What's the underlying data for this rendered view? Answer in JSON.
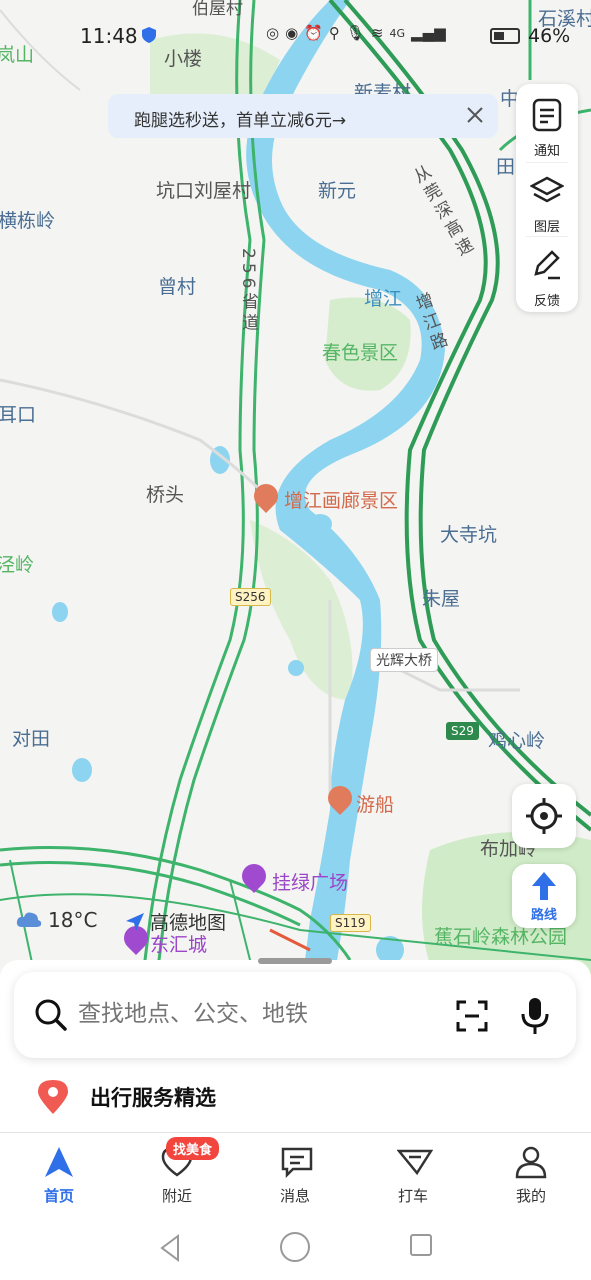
{
  "status_bar": {
    "time": "11:48",
    "battery_percent": "46%",
    "network": "4G"
  },
  "promo": {
    "text": "跑腿选秒送，首单立减6元→"
  },
  "tools": [
    {
      "label": "通知",
      "icon": "notification-icon"
    },
    {
      "label": "图层",
      "icon": "layers-icon"
    },
    {
      "label": "反馈",
      "icon": "feedback-icon"
    }
  ],
  "route_button": {
    "label": "路线"
  },
  "weather": {
    "temperature": "18°C"
  },
  "brand": {
    "name": "高德地图"
  },
  "map_labels": {
    "xiaolou": "小楼",
    "xinmaicun": "新麦村",
    "kengkou": "坑口刘屋村",
    "xinyuan": "新元",
    "hengdongling": "横栋岭",
    "zengcun": "曾村",
    "chunse": "春色景区",
    "zengjiang_river": "增江",
    "zengjiang_road": "增江路",
    "road_256": "256省道",
    "expressway": "从莞深高速",
    "qiaotou": "桥头",
    "huang_scenic": "增江画廊景区",
    "dasikeng": "大寺坑",
    "zhuwu": "朱屋",
    "duitian": "对田",
    "jixinling": "鸡心岭",
    "youchuan": "游船",
    "bujia": "布加岭",
    "guilu": "挂绿广场",
    "donghui": "东汇城",
    "jiaoshiling": "蕉石岭森林公园",
    "guanghui_bridge": "光辉大桥",
    "shixi": "石溪村",
    "jingling": "泾岭",
    "erkeng": "耳口",
    "shanlabel": "岚山",
    "zhong": "中",
    "tian": "田",
    "boushan": "伯屋村"
  },
  "road_signs": {
    "s256": "S256",
    "s29": "S29",
    "s119": "S119"
  },
  "search": {
    "placeholder": "查找地点、公交、地铁"
  },
  "service": {
    "title": "出行服务精选"
  },
  "tabs": [
    {
      "label": "首页",
      "icon": "home-navigation-icon",
      "active": true
    },
    {
      "label": "附近",
      "icon": "nearby-icon",
      "active": false,
      "badge": "找美食"
    },
    {
      "label": "消息",
      "icon": "message-icon",
      "active": false
    },
    {
      "label": "打车",
      "icon": "taxi-icon",
      "active": false
    },
    {
      "label": "我的",
      "icon": "profile-icon",
      "active": false
    }
  ],
  "colors": {
    "accent": "#2f6fe8",
    "river": "#8cd4f0",
    "green_area": "#cdecc5",
    "expressway": "#2e9b56",
    "badge": "#f2453d"
  }
}
